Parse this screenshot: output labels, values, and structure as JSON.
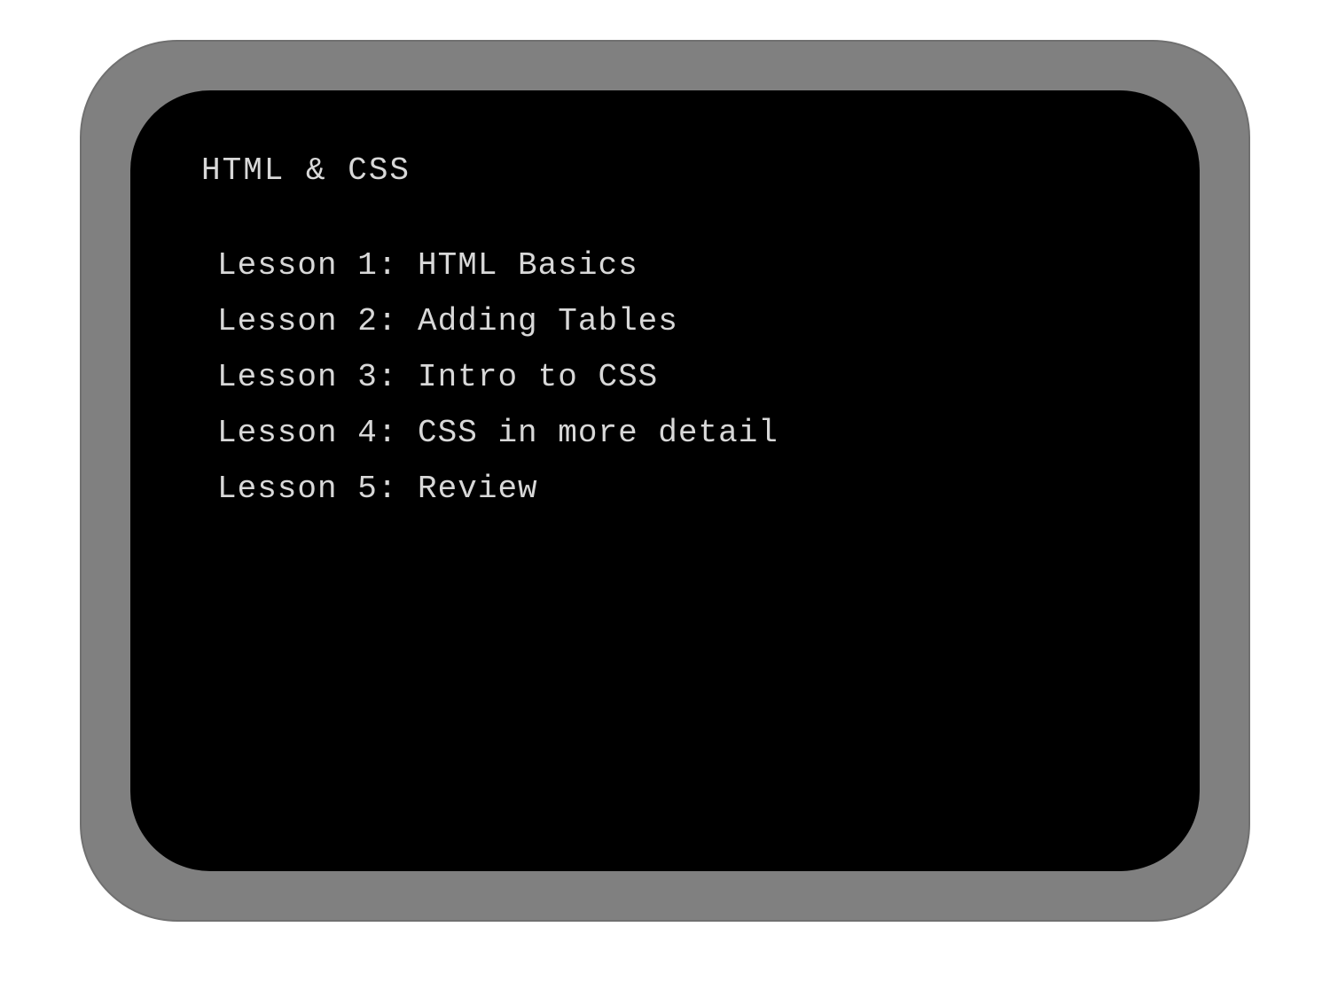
{
  "screen": {
    "title": "HTML & CSS",
    "lessons": [
      "Lesson 1: HTML Basics",
      "Lesson 2: Adding Tables",
      "Lesson 3: Intro to CSS",
      "Lesson 4: CSS in more detail",
      "Lesson 5: Review"
    ]
  }
}
